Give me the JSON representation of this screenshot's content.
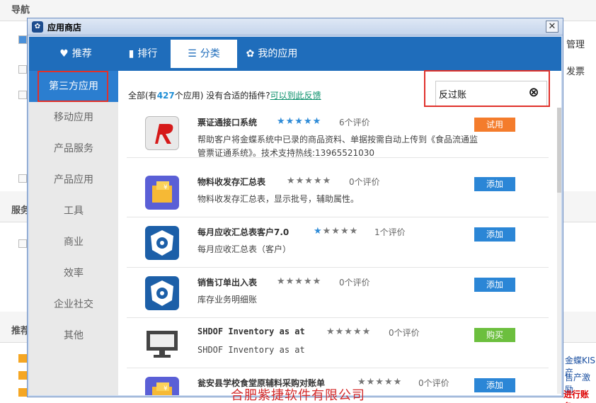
{
  "background": {
    "nav_title": "导航",
    "service_title": "服务",
    "recommend_title": "推荐",
    "right_text_1": "管理",
    "right_text_2": "发票",
    "right_link_1": "金蝶KIS产",
    "right_link_2": "售产激励",
    "right_link_3": "进行账务"
  },
  "dialog": {
    "title": "应用商店",
    "close": "✕"
  },
  "tabs": [
    {
      "label": "推荐",
      "icon": "heart-icon",
      "glyph": "♥"
    },
    {
      "label": "排行",
      "icon": "bar-chart-icon",
      "glyph": "▮"
    },
    {
      "label": "分类",
      "icon": "list-icon",
      "glyph": "☰"
    },
    {
      "label": "我的应用",
      "icon": "gear-icon",
      "glyph": "✿"
    }
  ],
  "sidebar": [
    "第三方应用",
    "移动应用",
    "产品服务",
    "产品应用",
    "工具",
    "商业",
    "效率",
    "企业社交",
    "其他"
  ],
  "summary": {
    "prefix": "全部(有",
    "count": "427",
    "suffix": "个应用) 没有合适的插件?",
    "link": "可以到此反馈"
  },
  "search": {
    "value": "反过账",
    "clear": "⊗"
  },
  "apps": [
    {
      "name": "票证通接口系统",
      "stars_on": 5,
      "reviews": "6个评价",
      "desc": "帮助客户将金蝶系统中已录的商品资料、单据按需自动上传到《食品流通监管票证通系统》。技术支持热线:13965521030",
      "action": "试用",
      "action_color": "#f47c2c",
      "icon": "piaozheng-app-icon"
    },
    {
      "name": "物料收发存汇总表",
      "stars_on": 0,
      "reviews": "0个评价",
      "desc": "物料收发存汇总表，显示批号，辅助属性。",
      "action": "添加",
      "action_color": "#2b86d6",
      "icon": "yellow-box-app-icon"
    },
    {
      "name": "每月应收汇总表客户7.0",
      "stars_on": 1,
      "reviews": "1个评价",
      "desc": "每月应收汇总表（客户）",
      "action": "添加",
      "action_color": "#2b86d6",
      "icon": "gear-shield-app-icon"
    },
    {
      "name": "销售订单出入表",
      "stars_on": 0,
      "reviews": "0个评价",
      "desc": "库存业务明细账",
      "action": "添加",
      "action_color": "#2b86d6",
      "icon": "gear-shield-app-icon"
    },
    {
      "name": "SHDOF Inventory as at",
      "stars_on": 0,
      "reviews": "0个评价",
      "desc": "SHDOF Inventory as at",
      "action": "购买",
      "action_color": "#6cbf3e",
      "icon": "monitor-app-icon"
    },
    {
      "name": "瓮安县学校食堂原辅料采购对账单",
      "stars_on": 0,
      "reviews": "0个评价",
      "desc": "",
      "action": "添加",
      "action_color": "#2b86d6",
      "icon": "yellow-box-app-icon"
    }
  ],
  "watermark": "合肥紫捷软件有限公司"
}
